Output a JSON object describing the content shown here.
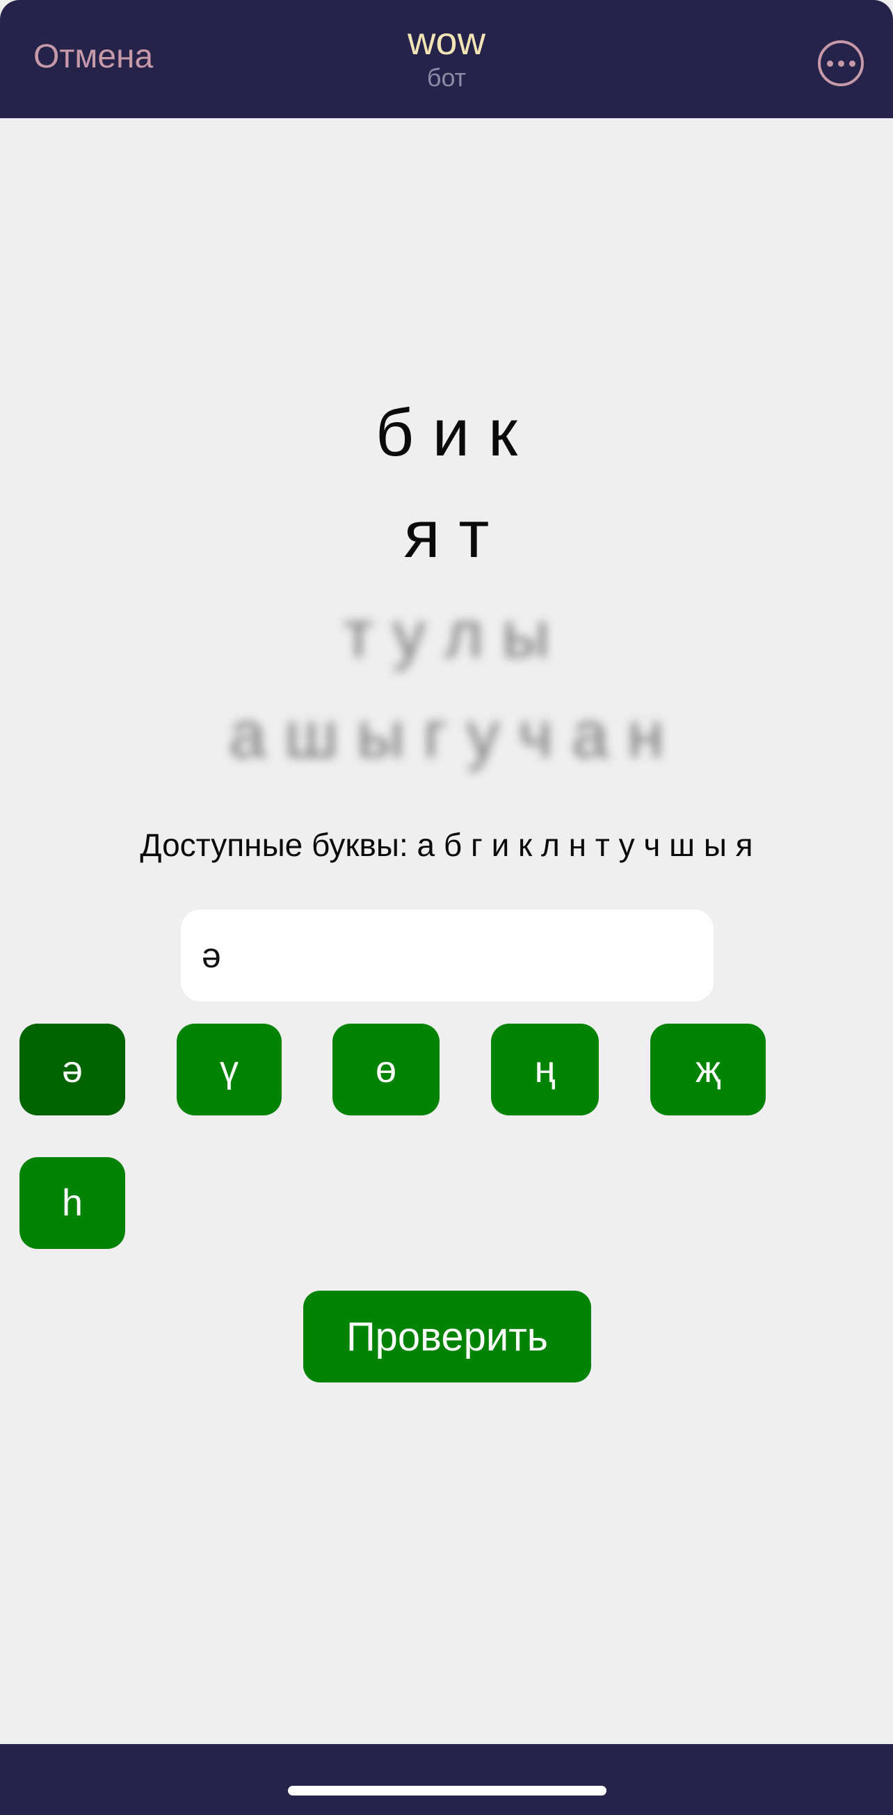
{
  "header": {
    "cancel_label": "Отмена",
    "title": "wow",
    "subtitle": "бот",
    "more_icon": "more-horizontal-icon"
  },
  "word_lines": [
    "б и к",
    "я т",
    "т у л ы",
    "а ш ы г у ч а н"
  ],
  "available_letters": "Доступные буквы: а б г и к л н т у ч ш ы я",
  "input": {
    "value": "ә"
  },
  "keys": [
    "ә",
    "ү",
    "ө",
    "ң",
    "җ",
    "һ"
  ],
  "check_button_label": "Проверить",
  "colors": {
    "header_bg": "#26234a",
    "key_green": "#038304",
    "key_active": "#016300",
    "accent_pink": "#c79aa9",
    "title_color": "#f3e4b5"
  }
}
